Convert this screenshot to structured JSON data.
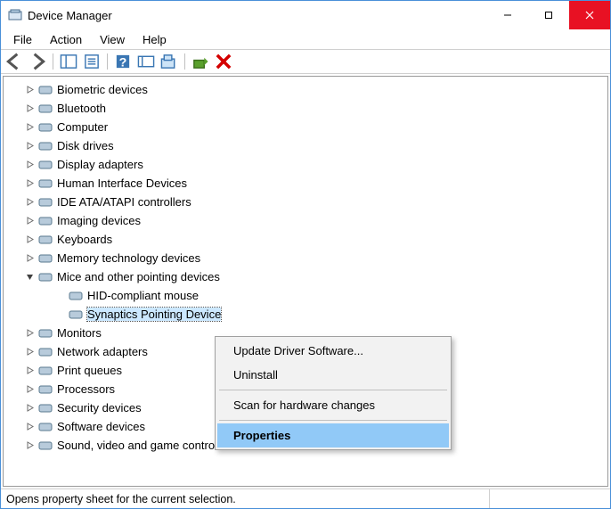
{
  "window": {
    "title": "Device Manager"
  },
  "menubar": {
    "items": [
      "File",
      "Action",
      "View",
      "Help"
    ]
  },
  "toolbar": {
    "buttons": [
      {
        "name": "back-icon"
      },
      {
        "name": "forward-icon"
      },
      {
        "name": "show-hide-tree-icon"
      },
      {
        "name": "properties-window-icon"
      },
      {
        "name": "help-icon"
      },
      {
        "name": "show-hidden-icon"
      },
      {
        "name": "scan-hardware-icon"
      },
      {
        "name": "update-driver-icon"
      },
      {
        "name": "uninstall-icon"
      }
    ]
  },
  "tree": {
    "items": [
      {
        "label": "Biometric devices",
        "expanded": false,
        "level": 1
      },
      {
        "label": "Bluetooth",
        "expanded": false,
        "level": 1
      },
      {
        "label": "Computer",
        "expanded": false,
        "level": 1
      },
      {
        "label": "Disk drives",
        "expanded": false,
        "level": 1
      },
      {
        "label": "Display adapters",
        "expanded": false,
        "level": 1
      },
      {
        "label": "Human Interface Devices",
        "expanded": false,
        "level": 1
      },
      {
        "label": "IDE ATA/ATAPI controllers",
        "expanded": false,
        "level": 1
      },
      {
        "label": "Imaging devices",
        "expanded": false,
        "level": 1
      },
      {
        "label": "Keyboards",
        "expanded": false,
        "level": 1
      },
      {
        "label": "Memory technology devices",
        "expanded": false,
        "level": 1
      },
      {
        "label": "Mice and other pointing devices",
        "expanded": true,
        "level": 1
      },
      {
        "label": "HID-compliant mouse",
        "expanded": null,
        "level": 2
      },
      {
        "label": "Synaptics Pointing Device",
        "expanded": null,
        "level": 2,
        "selected": true
      },
      {
        "label": "Monitors",
        "expanded": false,
        "level": 1
      },
      {
        "label": "Network adapters",
        "expanded": false,
        "level": 1
      },
      {
        "label": "Print queues",
        "expanded": false,
        "level": 1
      },
      {
        "label": "Processors",
        "expanded": false,
        "level": 1
      },
      {
        "label": "Security devices",
        "expanded": false,
        "level": 1
      },
      {
        "label": "Software devices",
        "expanded": false,
        "level": 1
      },
      {
        "label": "Sound, video and game controllers",
        "expanded": false,
        "level": 1
      }
    ]
  },
  "context_menu": {
    "items": [
      {
        "label": "Update Driver Software...",
        "highlight": false
      },
      {
        "label": "Uninstall",
        "highlight": false
      },
      {
        "separator": true
      },
      {
        "label": "Scan for hardware changes",
        "highlight": false
      },
      {
        "separator": true
      },
      {
        "label": "Properties",
        "highlight": true
      }
    ]
  },
  "statusbar": {
    "text": "Opens property sheet for the current selection."
  }
}
